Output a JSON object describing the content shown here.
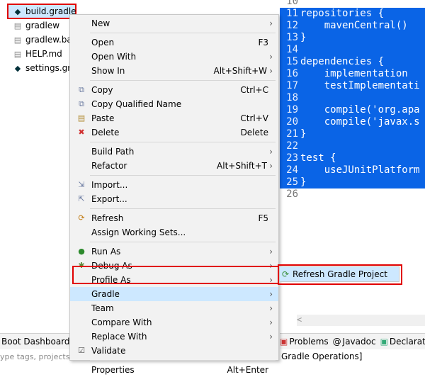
{
  "explorer": {
    "items": [
      {
        "label": "build.gradle",
        "icon": "gradle-elephant-icon"
      },
      {
        "label": "gradlew",
        "icon": "file-icon"
      },
      {
        "label": "gradlew.bat",
        "icon": "file-icon"
      },
      {
        "label": "HELP.md",
        "icon": "file-icon"
      },
      {
        "label": "settings.grac",
        "icon": "gradle-elephant-icon"
      }
    ]
  },
  "editor": {
    "lines": [
      {
        "num": "10",
        "text": "",
        "hl": false
      },
      {
        "num": "11",
        "text": "repositories {",
        "hl": true
      },
      {
        "num": "12",
        "text": "    mavenCentral()",
        "hl": true
      },
      {
        "num": "13",
        "text": "}",
        "hl": true
      },
      {
        "num": "14",
        "text": "",
        "hl": true
      },
      {
        "num": "15",
        "text": "dependencies {",
        "hl": true
      },
      {
        "num": "16",
        "text": "    implementation",
        "hl": true
      },
      {
        "num": "17",
        "text": "    testImplementati",
        "hl": true
      },
      {
        "num": "18",
        "text": "",
        "hl": true
      },
      {
        "num": "19",
        "text": "    compile('org.apa",
        "hl": true
      },
      {
        "num": "20",
        "text": "    compile('javax.s",
        "hl": true
      },
      {
        "num": "21",
        "text": "}",
        "hl": true
      },
      {
        "num": "22",
        "text": "",
        "hl": true
      },
      {
        "num": "23",
        "text": "test {",
        "hl": true
      },
      {
        "num": "24",
        "text": "    useJUnitPlatform",
        "hl": true
      },
      {
        "num": "25",
        "text": "}",
        "hl": true
      },
      {
        "num": "26",
        "text": "",
        "hl": false
      }
    ],
    "scroll_left": "<"
  },
  "bottom": {
    "boot_dashboard": "Boot Dashboard",
    "filter_hint": "ype tags, projects, or working set names to match (incl. * and ? wildcar",
    "tabs": [
      "Problems",
      "Javadoc",
      "Declaration"
    ],
    "gradle_ops": "Gradle Operations]"
  },
  "context_menu": {
    "items": [
      {
        "label": "New",
        "shortcut": "",
        "submenu": true,
        "icon": ""
      },
      {
        "sep": true
      },
      {
        "label": "Open",
        "shortcut": "F3",
        "submenu": false,
        "icon": ""
      },
      {
        "label": "Open With",
        "shortcut": "",
        "submenu": true,
        "icon": ""
      },
      {
        "label": "Show In",
        "shortcut": "Alt+Shift+W",
        "submenu": true,
        "icon": ""
      },
      {
        "sep": true
      },
      {
        "label": "Copy",
        "shortcut": "Ctrl+C",
        "submenu": false,
        "icon": "copy-icon"
      },
      {
        "label": "Copy Qualified Name",
        "shortcut": "",
        "submenu": false,
        "icon": "copy-qualified-icon"
      },
      {
        "label": "Paste",
        "shortcut": "Ctrl+V",
        "submenu": false,
        "icon": "paste-icon"
      },
      {
        "label": "Delete",
        "shortcut": "Delete",
        "submenu": false,
        "icon": "delete-icon"
      },
      {
        "sep": true
      },
      {
        "label": "Build Path",
        "shortcut": "",
        "submenu": true,
        "icon": ""
      },
      {
        "label": "Refactor",
        "shortcut": "Alt+Shift+T",
        "submenu": true,
        "icon": ""
      },
      {
        "sep": true
      },
      {
        "label": "Import...",
        "shortcut": "",
        "submenu": false,
        "icon": "import-icon"
      },
      {
        "label": "Export...",
        "shortcut": "",
        "submenu": false,
        "icon": "export-icon"
      },
      {
        "sep": true
      },
      {
        "label": "Refresh",
        "shortcut": "F5",
        "submenu": false,
        "icon": "refresh-icon"
      },
      {
        "label": "Assign Working Sets...",
        "shortcut": "",
        "submenu": false,
        "icon": ""
      },
      {
        "sep": true
      },
      {
        "label": "Run As",
        "shortcut": "",
        "submenu": true,
        "icon": "run-icon"
      },
      {
        "label": "Debug As",
        "shortcut": "",
        "submenu": true,
        "icon": "debug-icon"
      },
      {
        "label": "Profile As",
        "shortcut": "",
        "submenu": true,
        "icon": ""
      },
      {
        "label": "Gradle",
        "shortcut": "",
        "submenu": true,
        "icon": "",
        "active": true
      },
      {
        "label": "Team",
        "shortcut": "",
        "submenu": true,
        "icon": ""
      },
      {
        "label": "Compare With",
        "shortcut": "",
        "submenu": true,
        "icon": ""
      },
      {
        "label": "Replace With",
        "shortcut": "",
        "submenu": true,
        "icon": ""
      },
      {
        "label": "Validate",
        "shortcut": "",
        "submenu": false,
        "icon": "checkbox-icon"
      },
      {
        "sep": true
      },
      {
        "label": "Properties",
        "shortcut": "Alt+Enter",
        "submenu": false,
        "icon": ""
      }
    ]
  },
  "gradle_submenu": {
    "item": "Refresh Gradle Project",
    "icon": "gradle-refresh-icon"
  },
  "colors": {
    "selection": "#cde8ff",
    "highlight_border": "#e00000",
    "editor_selection": "#0a64e6"
  }
}
